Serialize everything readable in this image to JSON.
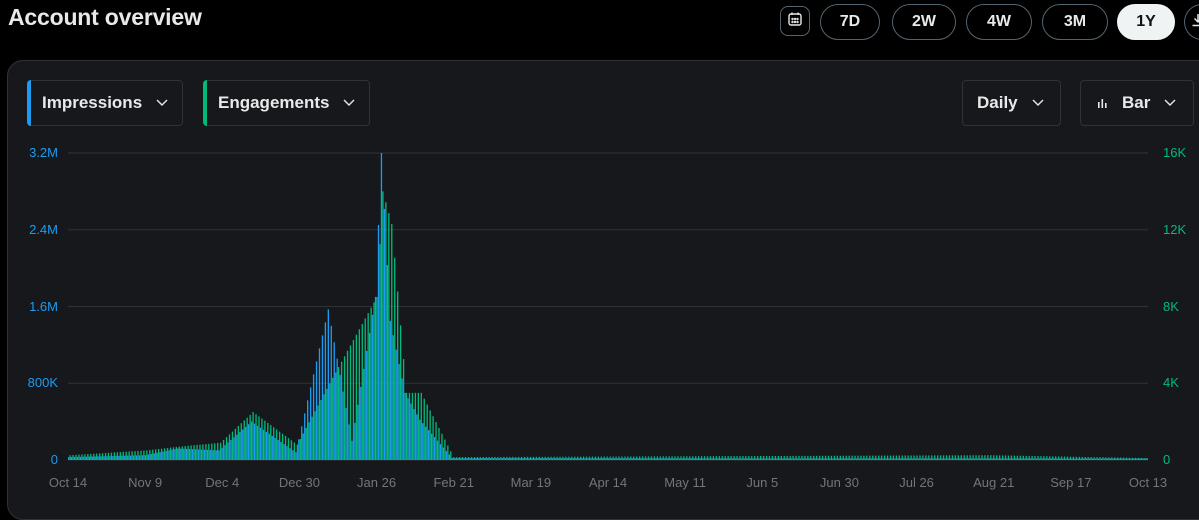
{
  "header": {
    "title": "Account overview"
  },
  "ranges": [
    {
      "label": "7D",
      "active": false
    },
    {
      "label": "2W",
      "active": false
    },
    {
      "label": "4W",
      "active": false
    },
    {
      "label": "3M",
      "active": false
    },
    {
      "label": "1Y",
      "active": true
    }
  ],
  "icons": {
    "calendar": "calendar-icon",
    "download": "download-icon",
    "chevron": "chevron-down-icon",
    "bar_chart": "bar-chart-icon"
  },
  "filters": {
    "metric1": {
      "label": "Impressions",
      "color": "#1d9bf0"
    },
    "metric2": {
      "label": "Engagements",
      "color": "#00ba7c"
    },
    "interval": {
      "label": "Daily"
    },
    "chart_type": {
      "label": "Bar"
    }
  },
  "chart_data": {
    "type": "bar",
    "x_tick_labels": [
      "Oct 14",
      "Nov 9",
      "Dec 4",
      "Dec 30",
      "Jan 26",
      "Feb 21",
      "Mar 19",
      "Apr 14",
      "May 11",
      "Jun 5",
      "Jun 30",
      "Jul 26",
      "Aug 21",
      "Sep 17",
      "Oct 13"
    ],
    "y_left_ticks": [
      "0",
      "800K",
      "1.6M",
      "2.4M",
      "3.2M"
    ],
    "y_right_ticks": [
      "0",
      "4K",
      "8K",
      "12K",
      "16K"
    ],
    "ylim_left": [
      0,
      3200000
    ],
    "ylim_right": [
      0,
      16000
    ],
    "grid": true,
    "series": [
      {
        "name": "Impressions",
        "axis": "left",
        "color": "#1d9bf0",
        "peaks": [
          {
            "date": "Oct 14",
            "value": 30000
          },
          {
            "date": "Nov 9",
            "value": 50000
          },
          {
            "date": "Nov 20",
            "value": 120000
          },
          {
            "date": "Dec 4",
            "value": 100000
          },
          {
            "date": "Dec 15",
            "value": 400000
          },
          {
            "date": "Dec 30",
            "value": 80000
          },
          {
            "date": "Jan 10",
            "value": 1570000
          },
          {
            "date": "Jan 18",
            "value": 200000
          },
          {
            "date": "Jan 26",
            "value": 1700000
          },
          {
            "date": "Jan 28",
            "value": 3200000
          },
          {
            "date": "Jan 31",
            "value": 1450000
          },
          {
            "date": "Feb 5",
            "value": 700000
          },
          {
            "date": "Feb 10",
            "value": 420000
          },
          {
            "date": "Feb 21",
            "value": 20000
          },
          {
            "date": "Oct 13",
            "value": 10000
          }
        ]
      },
      {
        "name": "Engagements",
        "axis": "right",
        "color": "#00ba7c",
        "peaks": [
          {
            "date": "Oct 14",
            "value": 250
          },
          {
            "date": "Nov 9",
            "value": 500
          },
          {
            "date": "Nov 20",
            "value": 700
          },
          {
            "date": "Dec 4",
            "value": 900
          },
          {
            "date": "Dec 15",
            "value": 2500
          },
          {
            "date": "Dec 30",
            "value": 800
          },
          {
            "date": "Jan 10",
            "value": 4000
          },
          {
            "date": "Jan 26",
            "value": 8500
          },
          {
            "date": "Jan 28",
            "value": 14000
          },
          {
            "date": "Jan 31",
            "value": 12300
          },
          {
            "date": "Feb 5",
            "value": 3500
          },
          {
            "date": "Feb 10",
            "value": 3500
          },
          {
            "date": "Feb 21",
            "value": 150
          },
          {
            "date": "Aug 21",
            "value": 250
          },
          {
            "date": "Oct 13",
            "value": 100
          }
        ]
      }
    ]
  }
}
